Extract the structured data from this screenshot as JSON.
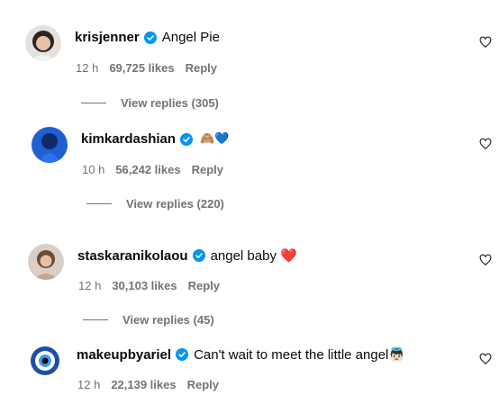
{
  "comments": [
    {
      "username": "krisjenner",
      "text": "Angel Pie",
      "time": "12 h",
      "likes": "69,725 likes",
      "reply_label": "Reply",
      "view_replies": "View replies (305)"
    },
    {
      "username": "kimkardashian",
      "text": "🙈💙",
      "time": "10 h",
      "likes": "56,242 likes",
      "reply_label": "Reply",
      "view_replies": "View replies (220)"
    },
    {
      "username": "staskaranikolaou",
      "text": "angel baby ❤️",
      "time": "12 h",
      "likes": "30,103 likes",
      "reply_label": "Reply",
      "view_replies": "View replies (45)"
    },
    {
      "username": "makeupbyariel",
      "text": "Can't wait to meet the little angel👼🏻",
      "time": "12 h",
      "likes": "22,139 likes",
      "reply_label": "Reply"
    }
  ],
  "icons": {
    "verified": "verified-badge-icon",
    "like": "heart-outline-icon"
  },
  "colors": {
    "verified_blue": "#0095f6",
    "secondary_text": "#737373"
  }
}
